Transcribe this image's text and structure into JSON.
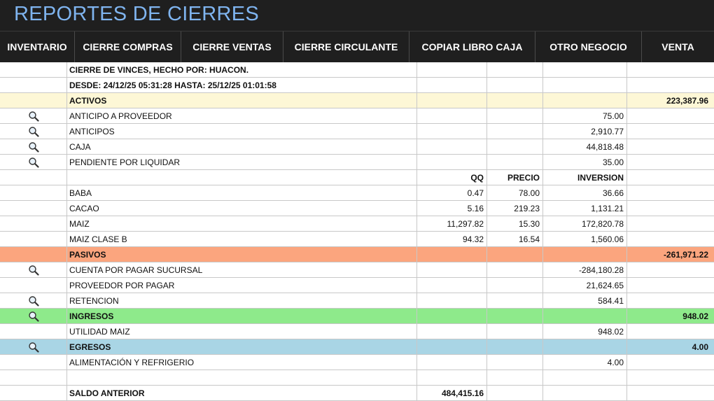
{
  "title": "REPORTES DE CIERRES",
  "nav": [
    {
      "label": "INVENTARIO",
      "name": "nav-inventario"
    },
    {
      "label": "CIERRE COMPRAS",
      "name": "nav-cierre-compras"
    },
    {
      "label": "CIERRE VENTAS",
      "name": "nav-cierre-ventas"
    },
    {
      "label": "CIERRE CIRCULANTE",
      "name": "nav-cierre-circulante"
    },
    {
      "label": "COPIAR LIBRO CAJA",
      "name": "nav-copiar-libro-caja"
    },
    {
      "label": "OTRO NEGOCIO",
      "name": "nav-otro-negocio"
    },
    {
      "label": "VENTA",
      "name": "nav-venta"
    }
  ],
  "report": {
    "header_line": "CIERRE DE VINCES, HECHO POR: HUACON.",
    "range_line": "DESDE: 24/12/25 05:31:28  HASTA: 25/12/25 01:01:58"
  },
  "rows": [
    {
      "type": "section",
      "style": "activos",
      "icon": false,
      "label": "ACTIVOS",
      "total": "223,387.96"
    },
    {
      "type": "item",
      "icon": true,
      "label": "ANTICIPO A PROVEEDOR",
      "qq": "",
      "precio": "",
      "inversion": "75.00"
    },
    {
      "type": "item",
      "icon": true,
      "label": "ANTICIPOS",
      "qq": "",
      "precio": "",
      "inversion": "2,910.77"
    },
    {
      "type": "item",
      "icon": true,
      "label": "CAJA",
      "qq": "",
      "precio": "",
      "inversion": "44,818.48"
    },
    {
      "type": "item",
      "icon": true,
      "label": "PENDIENTE POR LIQUIDAR",
      "qq": "",
      "precio": "",
      "inversion": "35.00"
    },
    {
      "type": "colhdr",
      "qq": "QQ",
      "precio": "PRECIO",
      "inversion": "INVERSION"
    },
    {
      "type": "item",
      "icon": false,
      "label": "BABA",
      "qq": "0.47",
      "precio": "78.00",
      "inversion": "36.66"
    },
    {
      "type": "item",
      "icon": false,
      "label": "CACAO",
      "qq": "5.16",
      "precio": "219.23",
      "inversion": "1,131.21"
    },
    {
      "type": "item",
      "icon": false,
      "label": "MAIZ",
      "qq": "11,297.82",
      "precio": "15.30",
      "inversion": "172,820.78"
    },
    {
      "type": "item",
      "icon": false,
      "label": "MAIZ CLASE B",
      "qq": "94.32",
      "precio": "16.54",
      "inversion": "1,560.06"
    },
    {
      "type": "section",
      "style": "pasivos",
      "icon": false,
      "label": "PASIVOS",
      "total": "-261,971.22"
    },
    {
      "type": "item",
      "icon": true,
      "label": "CUENTA POR PAGAR SUCURSAL",
      "qq": "",
      "precio": "",
      "inversion": "-284,180.28"
    },
    {
      "type": "item",
      "icon": false,
      "label": "PROVEEDOR POR PAGAR",
      "qq": "",
      "precio": "",
      "inversion": "21,624.65"
    },
    {
      "type": "item",
      "icon": true,
      "label": "RETENCION",
      "qq": "",
      "precio": "",
      "inversion": "584.41"
    },
    {
      "type": "section",
      "style": "ingresos",
      "icon": true,
      "label": "INGRESOS",
      "total": "948.02"
    },
    {
      "type": "item",
      "icon": false,
      "label": "UTILIDAD MAIZ",
      "qq": "",
      "precio": "",
      "inversion": "948.02"
    },
    {
      "type": "section",
      "style": "egresos",
      "icon": true,
      "label": "EGRESOS",
      "total": "4.00"
    },
    {
      "type": "item",
      "icon": false,
      "label": "ALIMENTACIÓN Y REFRIGERIO",
      "qq": "",
      "precio": "",
      "inversion": "4.00"
    },
    {
      "type": "blank"
    },
    {
      "type": "saldo",
      "label": "SALDO ANTERIOR",
      "qq": "484,415.16"
    }
  ]
}
